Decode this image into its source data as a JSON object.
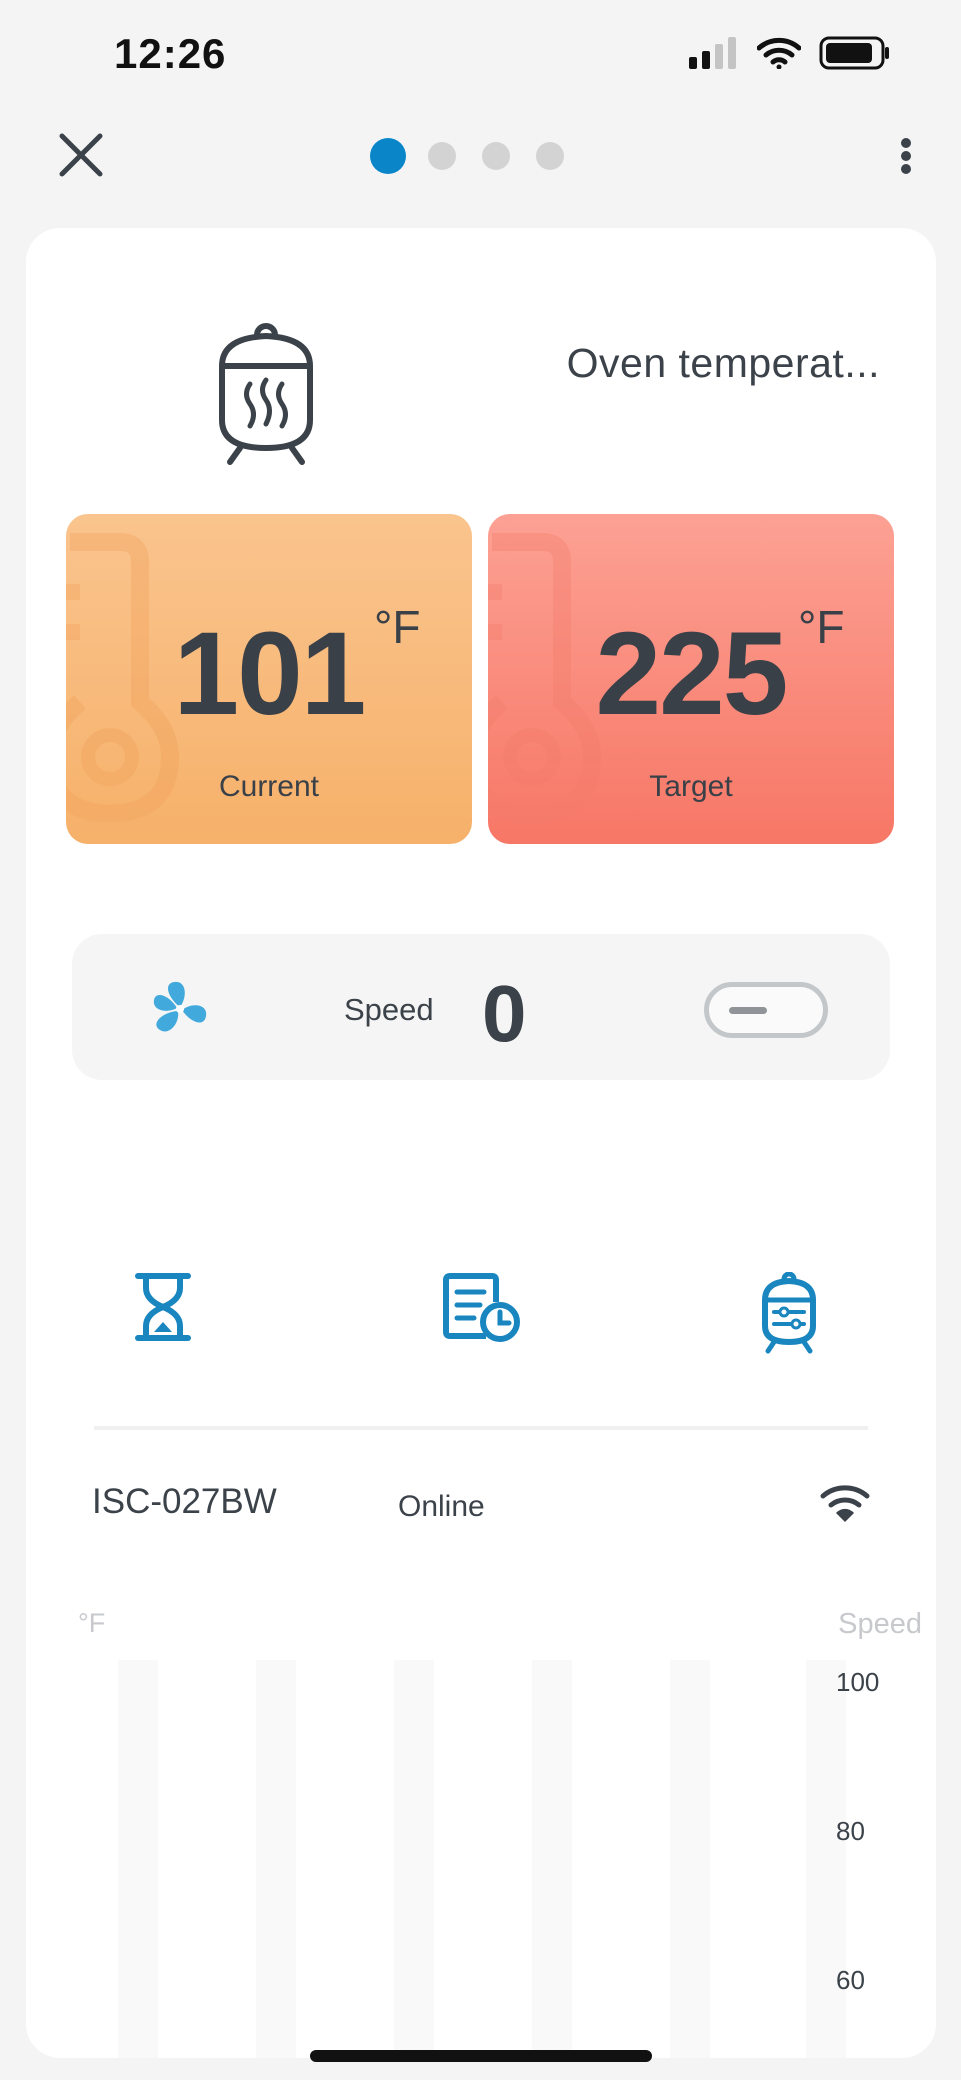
{
  "status": {
    "time": "12:26"
  },
  "nav": {
    "dots": 4,
    "active_dot": 0
  },
  "header": {
    "title": "Oven temperat..."
  },
  "current": {
    "value": "101",
    "unit": "°F",
    "label": "Current"
  },
  "target": {
    "value": "225",
    "unit": "°F",
    "label": "Target"
  },
  "speed": {
    "label": "Speed",
    "value": "0"
  },
  "device": {
    "id": "ISC-027BW",
    "status": "Online"
  },
  "chart_data": {
    "type": "bar",
    "left_unit": "°F",
    "right_unit": "Speed",
    "right_ticks": [
      "100",
      "80",
      "60"
    ],
    "ylim_right": [
      60,
      100
    ]
  },
  "colors": {
    "accent": "#0a86c8",
    "current_tile": "#f6b16a",
    "target_tile": "#f77766",
    "fan": "#42a9dc",
    "text": "#3b4249"
  }
}
